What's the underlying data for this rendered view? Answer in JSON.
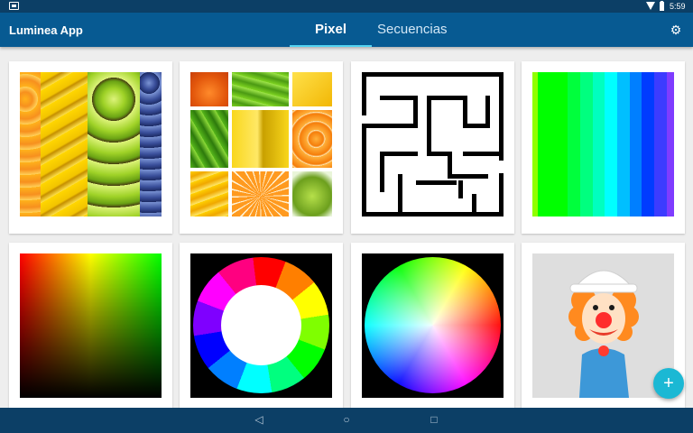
{
  "status_bar": {
    "time": "5:59"
  },
  "app_bar": {
    "title": "Luminea App",
    "tabs": [
      {
        "label": "Pixel",
        "selected": true
      },
      {
        "label": "Secuencias",
        "selected": false
      }
    ],
    "settings_icon": "gear-icon"
  },
  "gallery": {
    "items": [
      {
        "name": "fruits-vertical"
      },
      {
        "name": "fruits-collage"
      },
      {
        "name": "maze"
      },
      {
        "name": "color-stripes"
      },
      {
        "name": "red-green-gradient"
      },
      {
        "name": "color-ring"
      },
      {
        "name": "color-wheel"
      },
      {
        "name": "clown"
      }
    ]
  },
  "fab": {
    "icon": "plus-icon",
    "glyph": "+"
  },
  "nav_bar": {
    "back": "◁",
    "home": "○",
    "recents": "□"
  },
  "colors": {
    "status_bar": "#0c3f66",
    "app_bar": "#075a92",
    "tab_indicator": "#53d3f1",
    "fab": "#1bb8d4",
    "background": "#eeeeee"
  }
}
